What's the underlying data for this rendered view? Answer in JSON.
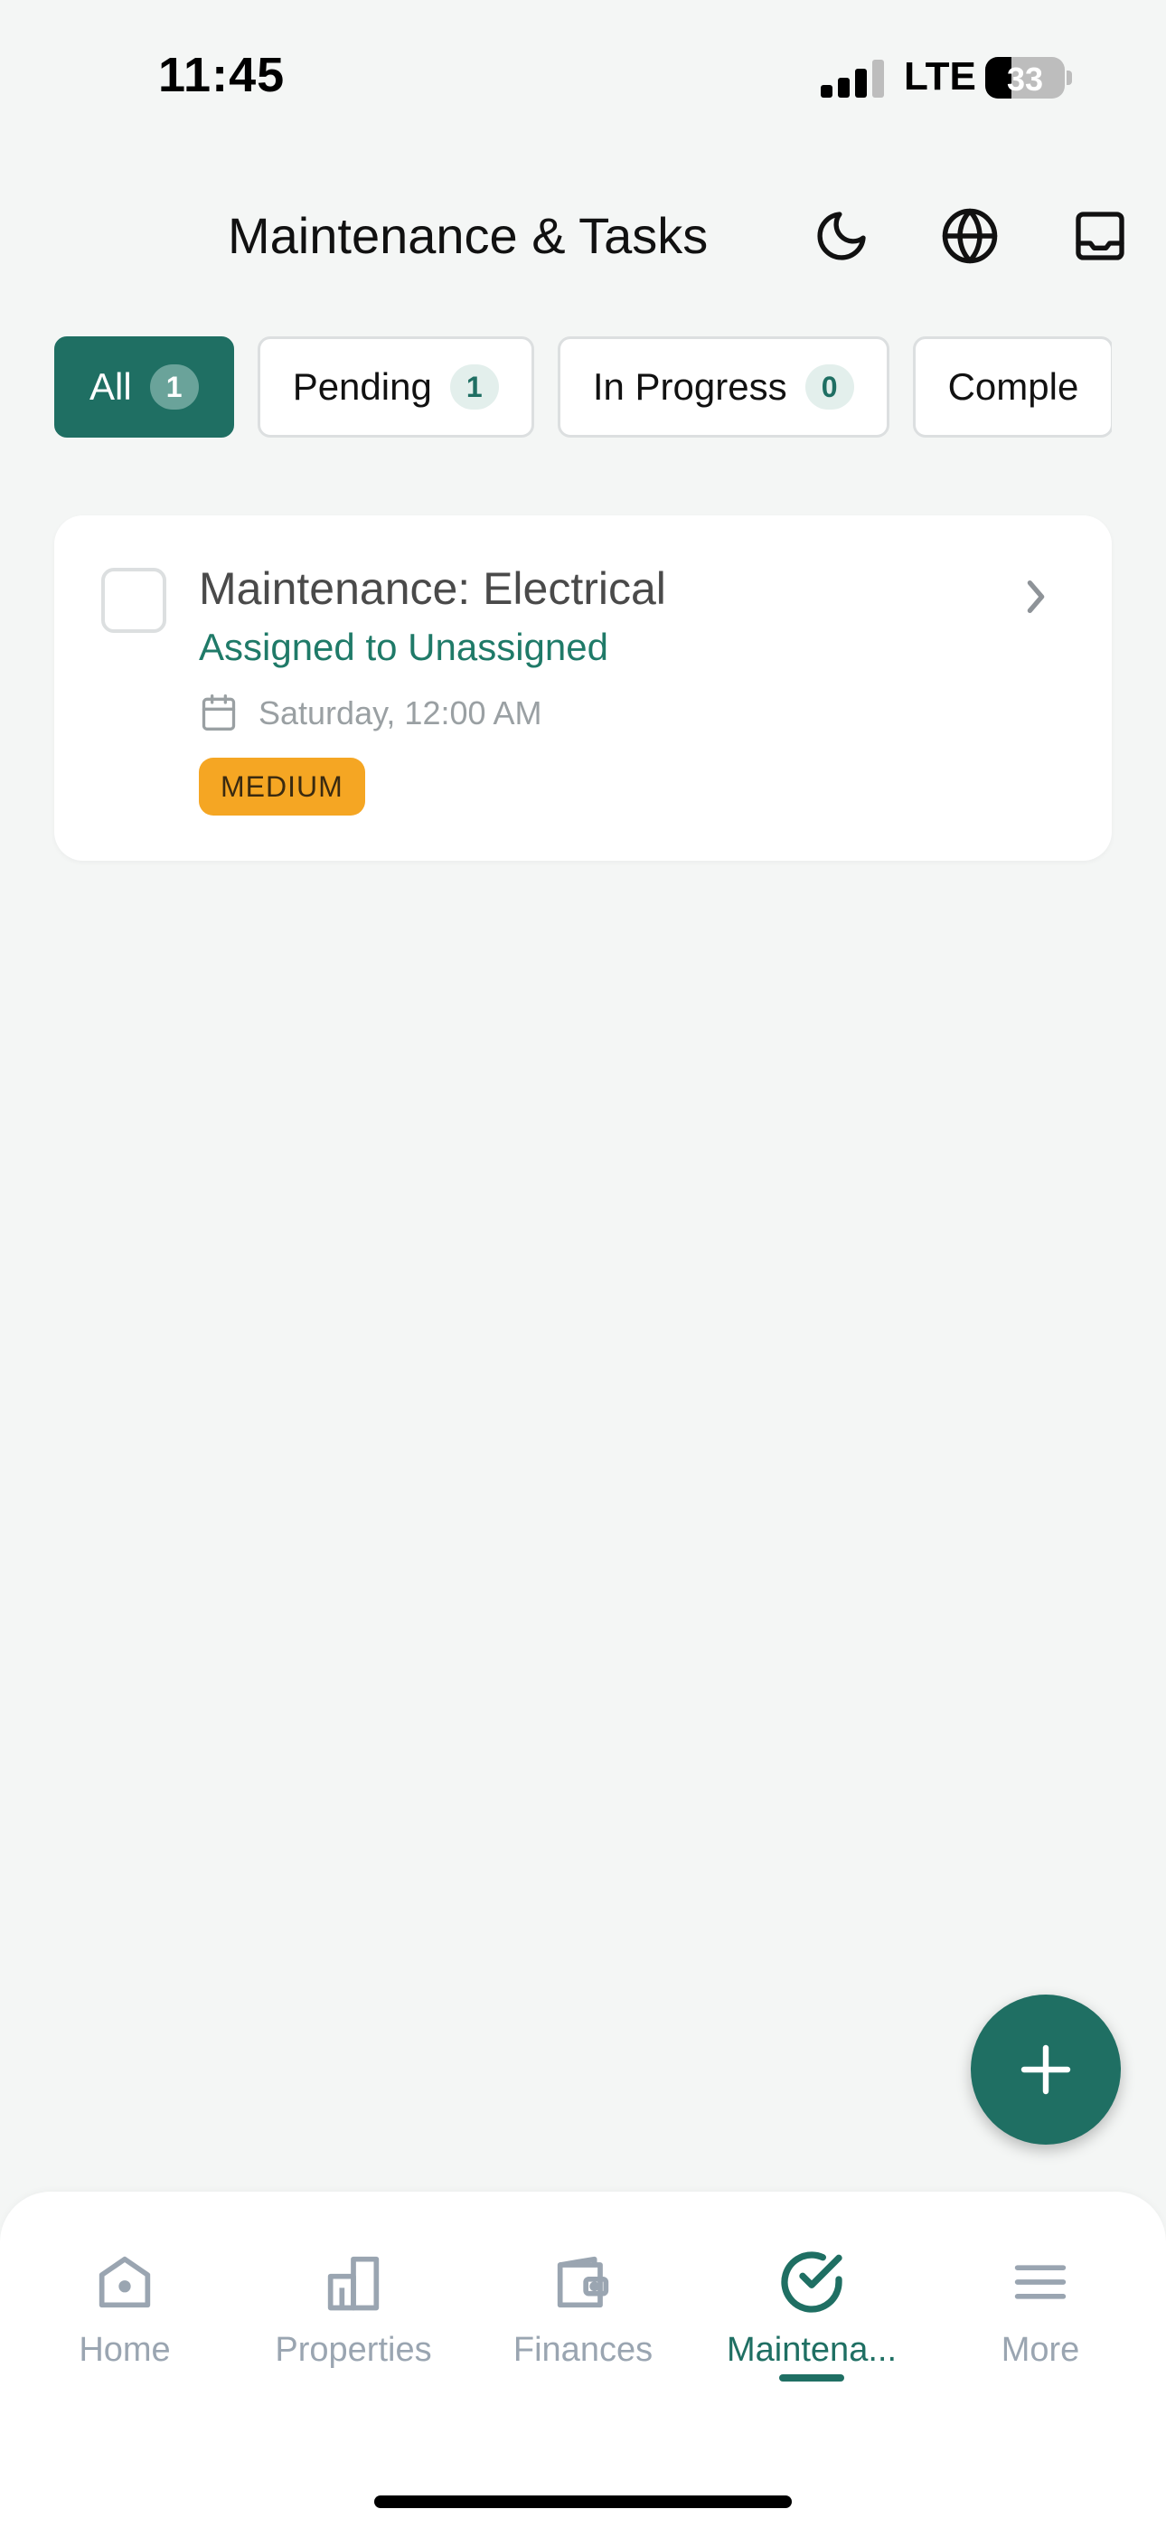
{
  "status_bar": {
    "time": "11:45",
    "signal_bars_active": 3,
    "signal_bars_total": 4,
    "network": "LTE",
    "battery_percent": "33"
  },
  "header": {
    "title": "Maintenance & Tasks",
    "icons": [
      "moon-icon",
      "globe-icon",
      "inbox-icon"
    ]
  },
  "tabs": [
    {
      "label": "All",
      "count": "1",
      "active": true
    },
    {
      "label": "Pending",
      "count": "1",
      "active": false
    },
    {
      "label": "In Progress",
      "count": "0",
      "active": false
    },
    {
      "label": "Comple",
      "count": "",
      "active": false
    }
  ],
  "tasks": [
    {
      "title": "Maintenance: Electrical",
      "assignment": "Assigned to Unassigned",
      "date": "Saturday, 12:00 AM",
      "priority": "MEDIUM"
    }
  ],
  "fab": {
    "icon": "plus-icon"
  },
  "bottom_nav": [
    {
      "label": "Home",
      "icon": "home-icon",
      "active": false
    },
    {
      "label": "Properties",
      "icon": "building-icon",
      "active": false
    },
    {
      "label": "Finances",
      "icon": "wallet-icon",
      "active": false
    },
    {
      "label": "Maintena...",
      "icon": "check-circle-icon",
      "active": true
    },
    {
      "label": "More",
      "icon": "menu-icon",
      "active": false
    }
  ],
  "colors": {
    "accent": "#1f6f63",
    "assign_text": "#1f7a68",
    "priority_medium": "#f5a623",
    "nav_inactive": "#9aa5b1",
    "background": "#f4f6f5"
  }
}
